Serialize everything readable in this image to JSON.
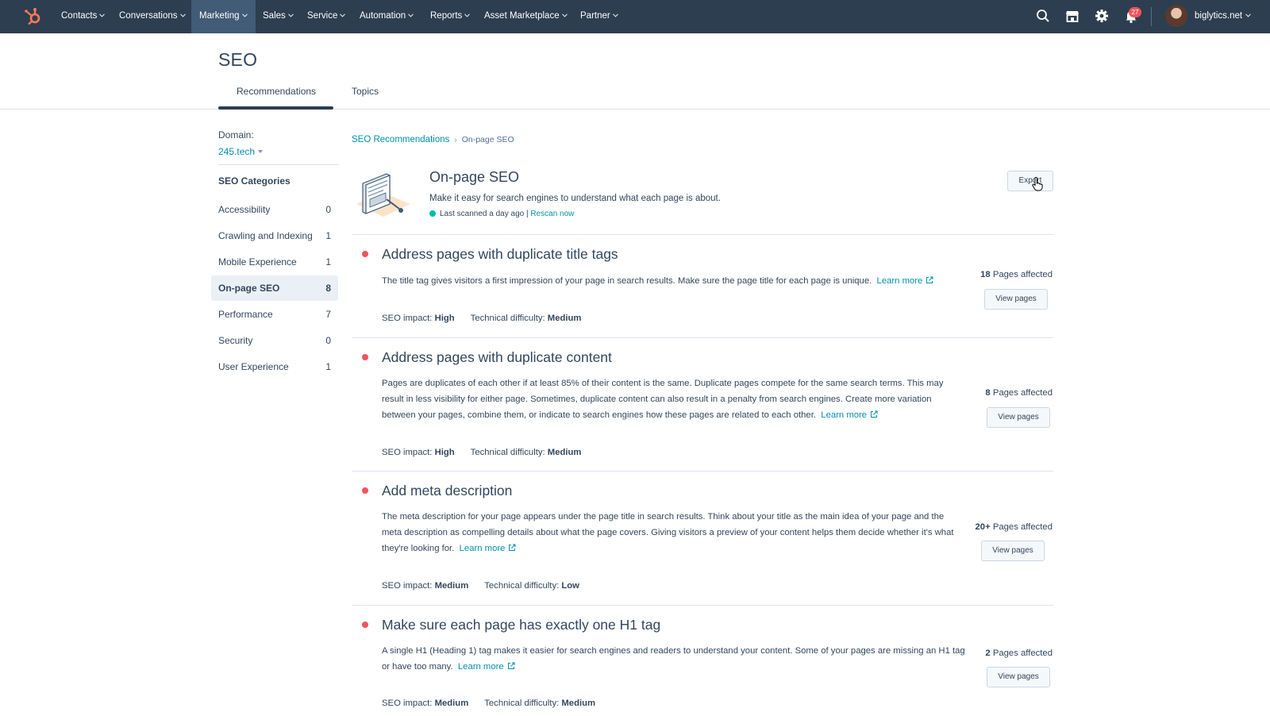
{
  "nav": {
    "items": [
      {
        "label": "Contacts"
      },
      {
        "label": "Conversations"
      },
      {
        "label": "Marketing"
      },
      {
        "label": "Sales"
      },
      {
        "label": "Service"
      },
      {
        "label": "Automation"
      },
      {
        "label": "Reports"
      },
      {
        "label": "Asset Marketplace"
      },
      {
        "label": "Partner"
      }
    ],
    "active": "Marketing",
    "notification_count": "27",
    "account_name": "biglytics.net",
    "icons": [
      "sprocket-logo-icon",
      "search-icon",
      "marketplace-icon",
      "gear-icon",
      "bell-icon",
      "avatar"
    ]
  },
  "page": {
    "title": "SEO",
    "tabs": [
      {
        "label": "Recommendations",
        "active": true
      },
      {
        "label": "Topics",
        "active": false
      }
    ]
  },
  "sidebar": {
    "domain_label": "Domain:",
    "domain_value": "245.tech",
    "categories_heading": "SEO Categories",
    "items": [
      {
        "label": "Accessibility",
        "count": "0"
      },
      {
        "label": "Crawling and Indexing",
        "count": "1"
      },
      {
        "label": "Mobile Experience",
        "count": "1"
      },
      {
        "label": "On-page SEO",
        "count": "8",
        "active": true
      },
      {
        "label": "Performance",
        "count": "7"
      },
      {
        "label": "Security",
        "count": "0"
      },
      {
        "label": "User Experience",
        "count": "1"
      }
    ]
  },
  "main": {
    "breadcrumb": {
      "root": "SEO Recommendations",
      "current": "On-page SEO"
    },
    "hero": {
      "title": "On-page SEO",
      "description": "Make it easy for search engines to understand what each page is about.",
      "scan_status": "Last scanned a day ago",
      "scan_separator": "|",
      "rescan_label": "Rescan now"
    },
    "export_label": "Export",
    "recommendations": [
      {
        "title": "Address pages with duplicate title tags",
        "description": "The title tag gives visitors a first impression of your page in search results. Make sure the page title for each page is unique.",
        "learn_more": "Learn more",
        "impact_label": "SEO impact:",
        "impact": "High",
        "difficulty_label": "Technical difficulty:",
        "difficulty": "Medium",
        "affected_count": "18",
        "affected_label": "Pages affected",
        "view_label": "View pages"
      },
      {
        "title": "Address pages with duplicate content",
        "description": "Pages are duplicates of each other if at least 85% of their content is the same. Duplicate pages compete for the same search terms. This may result in less visibility for either page. Sometimes, duplicate content can also result in a penalty from search engines. Create more variation between your pages, combine them, or indicate to search engines how these pages are related to each other.",
        "learn_more": "Learn more",
        "impact_label": "SEO impact:",
        "impact": "High",
        "difficulty_label": "Technical difficulty:",
        "difficulty": "Medium",
        "affected_count": "8",
        "affected_label": "Pages affected",
        "view_label": "View pages"
      },
      {
        "title": "Add meta description",
        "description": "The meta description for your page appears under the page title in search results. Think about your title as the main idea of your page and the meta description as compelling details about what the page covers. Giving visitors a preview of your content helps them decide whether it's what they're looking for.",
        "learn_more": "Learn more",
        "impact_label": "SEO impact:",
        "impact": "Medium",
        "difficulty_label": "Technical difficulty:",
        "difficulty": "Low",
        "affected_count": "20+",
        "affected_label": "Pages affected",
        "view_label": "View pages"
      },
      {
        "title": "Make sure each page has exactly one H1 tag",
        "description": "A single H1 (Heading 1) tag makes it easier for search engines and readers to understand your content. Some of your pages are missing an H1 tag or have too many.",
        "learn_more": "Learn more",
        "impact_label": "SEO impact:",
        "impact": "Medium",
        "difficulty_label": "Technical difficulty:",
        "difficulty": "Medium",
        "affected_count": "2",
        "affected_label": "Pages affected",
        "view_label": "View pages"
      }
    ]
  }
}
